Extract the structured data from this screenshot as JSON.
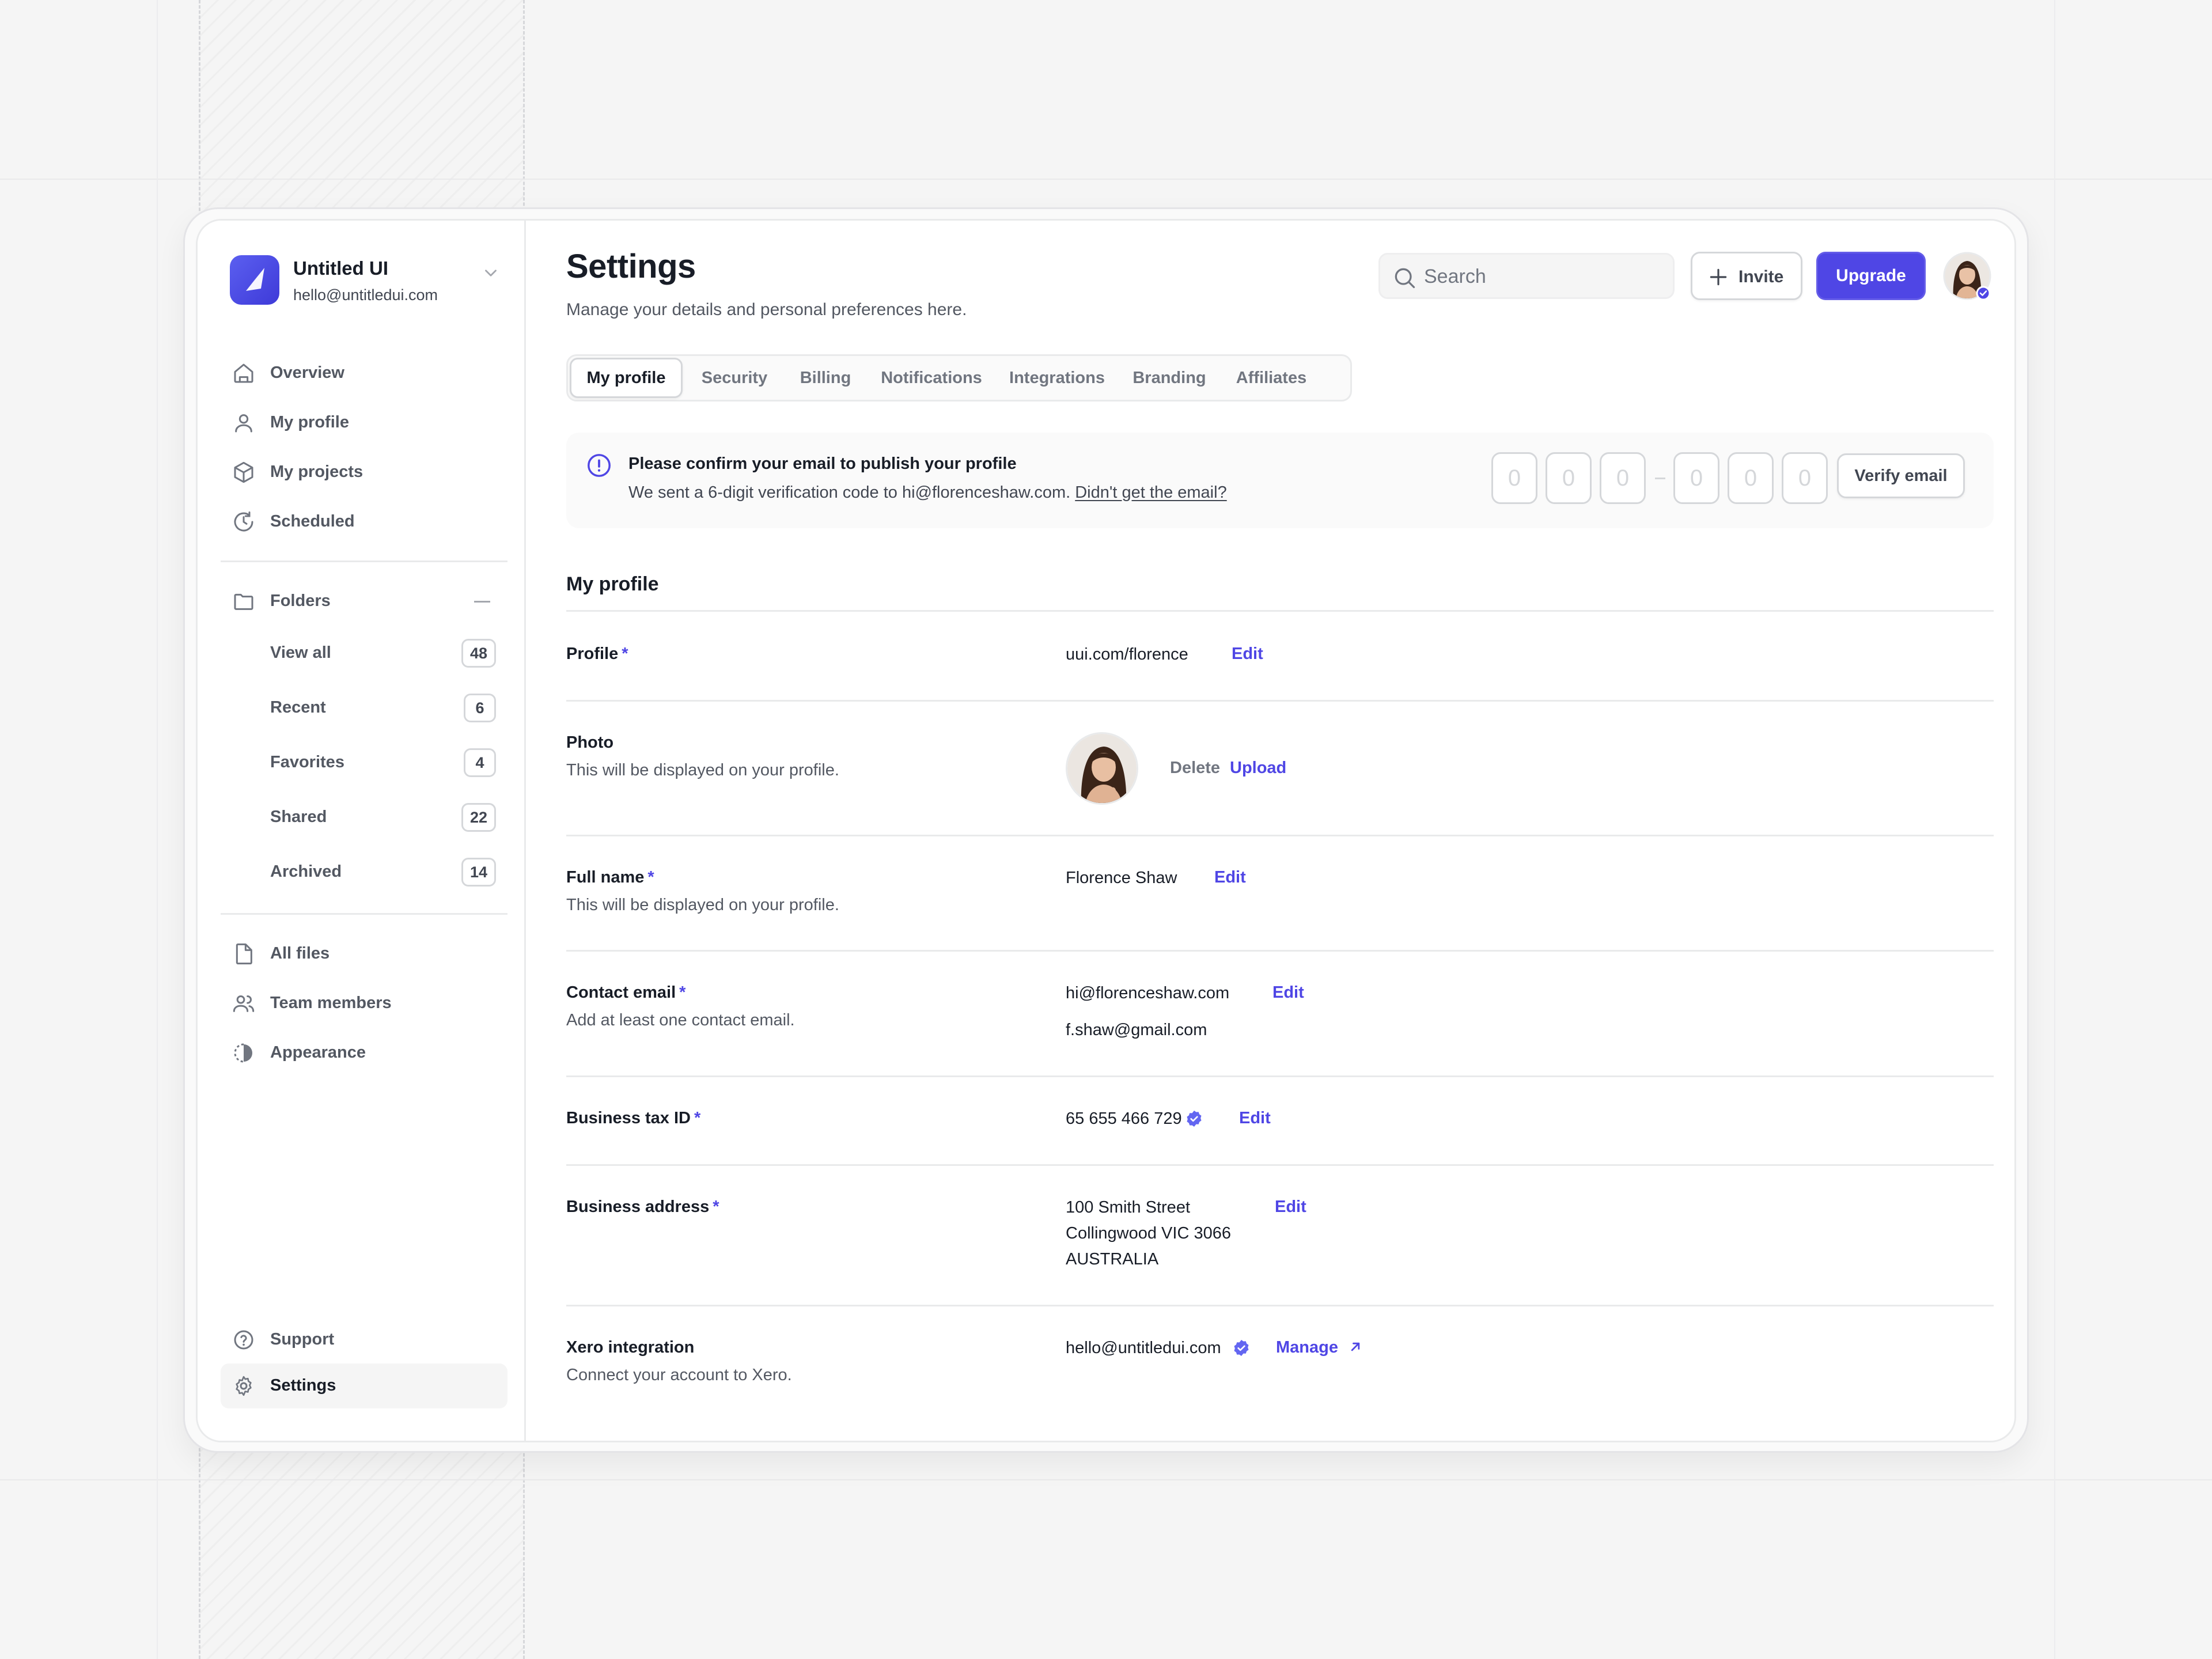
{
  "app": {
    "name": "Untitled UI",
    "email": "hello@untitledui.com"
  },
  "sidebar": {
    "nav": [
      {
        "label": "Overview",
        "icon": "home-icon"
      },
      {
        "label": "My profile",
        "icon": "user-icon"
      },
      {
        "label": "My projects",
        "icon": "box-icon"
      },
      {
        "label": "Scheduled",
        "icon": "clock-icon"
      }
    ],
    "folders": {
      "label": "Folders",
      "items": [
        {
          "label": "View all",
          "count": "48"
        },
        {
          "label": "Recent",
          "count": "6"
        },
        {
          "label": "Favorites",
          "count": "4"
        },
        {
          "label": "Shared",
          "count": "22"
        },
        {
          "label": "Archived",
          "count": "14"
        }
      ]
    },
    "secondary": [
      {
        "label": "All files",
        "icon": "file-icon"
      },
      {
        "label": "Team members",
        "icon": "users-icon"
      },
      {
        "label": "Appearance",
        "icon": "contrast-icon"
      }
    ],
    "footer": [
      {
        "label": "Support",
        "icon": "help-circle-icon"
      },
      {
        "label": "Settings",
        "icon": "gear-icon",
        "active": true
      }
    ]
  },
  "header": {
    "title": "Settings",
    "subtitle": "Manage your details and personal preferences here.",
    "search_placeholder": "Search",
    "invite_label": "Invite",
    "upgrade_label": "Upgrade"
  },
  "tabs": [
    {
      "label": "My profile",
      "active": true
    },
    {
      "label": "Security"
    },
    {
      "label": "Billing"
    },
    {
      "label": "Notifications"
    },
    {
      "label": "Integrations"
    },
    {
      "label": "Branding"
    },
    {
      "label": "Affiliates"
    }
  ],
  "alert": {
    "title": "Please confirm your email to publish your profile",
    "text": "We sent a 6-digit verification code to hi@florenceshaw.com.",
    "link": "Didn't get the email?",
    "code_digits": [
      "0",
      "0",
      "0",
      "0",
      "0",
      "0"
    ],
    "verify_label": "Verify email"
  },
  "profile": {
    "section_title": "My profile",
    "required_mark": "*",
    "edit_label": "Edit",
    "profile_label": "Profile",
    "profile_url": "uui.com/florence",
    "photo_label": "Photo",
    "photo_desc": "This will be displayed on your profile.",
    "delete_label": "Delete",
    "upload_label": "Upload",
    "fullname_label": "Full name",
    "fullname_desc": "This will be displayed on your profile.",
    "fullname_value": "Florence Shaw",
    "email_label": "Contact email",
    "email_desc": "Add at least one contact email.",
    "email_primary": "hi@florenceshaw.com",
    "email_secondary": "f.shaw@gmail.com",
    "tax_label": "Business tax ID",
    "tax_value": "65 655 466 729",
    "address_label": "Business address",
    "address_line1": "100 Smith Street",
    "address_line2": "Collingwood VIC 3066",
    "address_line3": "AUSTRALIA",
    "xero_label": "Xero integration",
    "xero_desc": "Connect your account to Xero.",
    "xero_value": "hello@untitledui.com",
    "manage_label": "Manage"
  },
  "colors": {
    "brand": "#4f46e5",
    "text": "#181d27",
    "muted": "#535862",
    "border": "#e9eaeb"
  }
}
